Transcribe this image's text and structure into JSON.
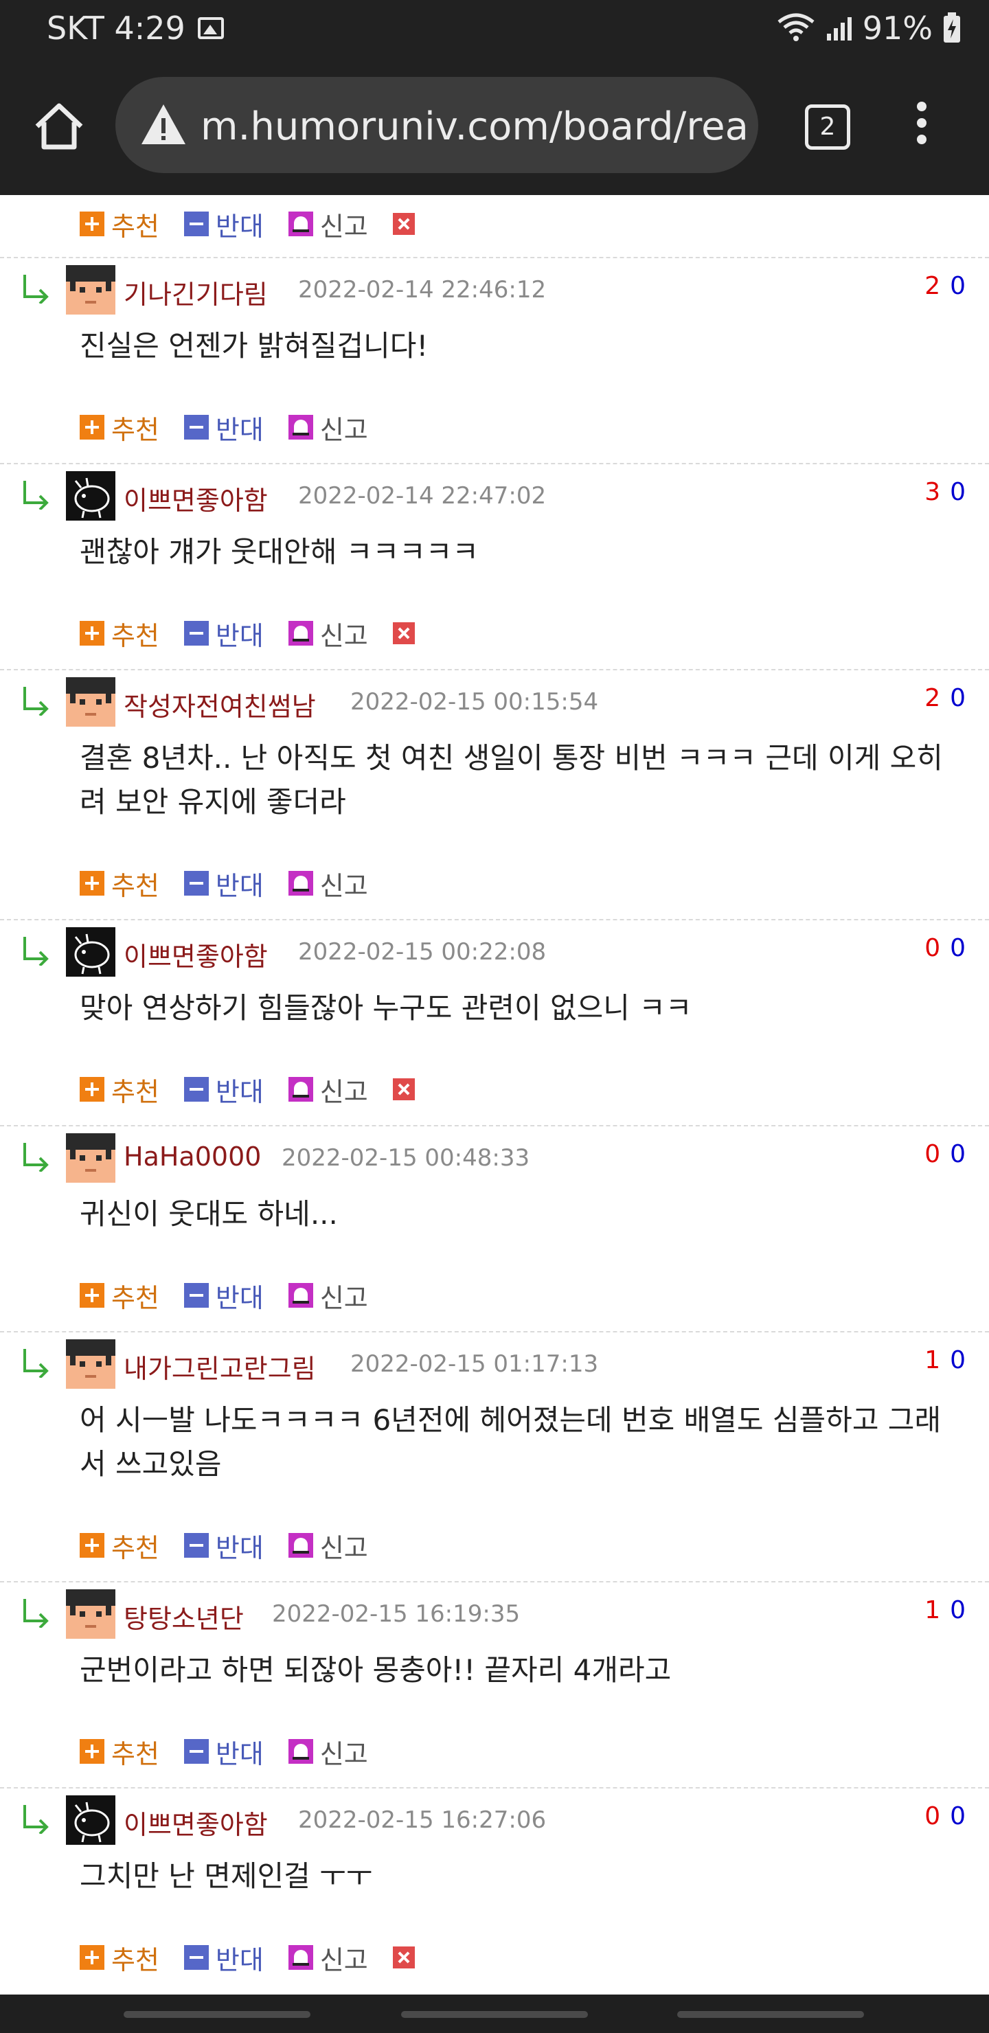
{
  "status_bar": {
    "carrier_time": "SKT 4:29",
    "battery": "91%"
  },
  "browser": {
    "url": "m.humoruniv.com/board/rea",
    "tab_count": "2"
  },
  "labels": {
    "recommend": "추천",
    "oppose": "반대",
    "report": "신고"
  },
  "comments": [
    {
      "avatar": "avatar-bangs-face",
      "nick": "기나긴기다림",
      "date": "2022-02-14 22:46:12",
      "up": "2",
      "down": "0",
      "text": "진실은 언젠가 밝혀질겁니다!",
      "has_delete": false
    },
    {
      "avatar": "avatar-pig-sketch",
      "nick": "이쁘면좋아함",
      "date": "2022-02-14 22:47:02",
      "up": "3",
      "down": "0",
      "text": "괜찮아 걔가 웃대안해 ㅋㅋㅋㅋㅋ",
      "has_delete": true
    },
    {
      "avatar": "avatar-bangs-face",
      "nick": "작성자전여친썸남",
      "date": "2022-02-15 00:15:54",
      "up": "2",
      "down": "0",
      "text": "결혼 8년차.. 난 아직도 첫 여친 생일이 통장 비번 ㅋㅋㅋ 근데 이게 오히려 보안 유지에 좋더라",
      "has_delete": false
    },
    {
      "avatar": "avatar-pig-sketch",
      "nick": "이쁘면좋아함",
      "date": "2022-02-15 00:22:08",
      "up": "0",
      "down": "0",
      "text": "맞아 연상하기 힘들잖아 누구도 관련이 없으니 ㅋㅋ",
      "has_delete": true
    },
    {
      "avatar": "avatar-bangs-face",
      "nick": "HaHa0000",
      "date": "2022-02-15 00:48:33",
      "up": "0",
      "down": "0",
      "text": "귀신이 웃대도 하네...",
      "has_delete": false
    },
    {
      "avatar": "avatar-bangs-face",
      "nick": "내가그린고란그림",
      "date": "2022-02-15 01:17:13",
      "up": "1",
      "down": "0",
      "text": "어 시ㅡ발 나도ㅋㅋㅋㅋ 6년전에 헤어졌는데 번호 배열도 심플하고 그래서 쓰고있음",
      "has_delete": false
    },
    {
      "avatar": "avatar-bangs-face",
      "nick": "탕탕소년단",
      "date": "2022-02-15 16:19:35",
      "up": "1",
      "down": "0",
      "text": "군번이라고 하면 되잖아 몽충아!! 끝자리 4개라고",
      "has_delete": false
    },
    {
      "avatar": "avatar-pig-sketch",
      "nick": "이쁘면좋아함",
      "date": "2022-02-15 16:27:06",
      "up": "0",
      "down": "0",
      "text": "그치만 난 면제인걸 ㅜㅜ",
      "has_delete": true
    }
  ]
}
